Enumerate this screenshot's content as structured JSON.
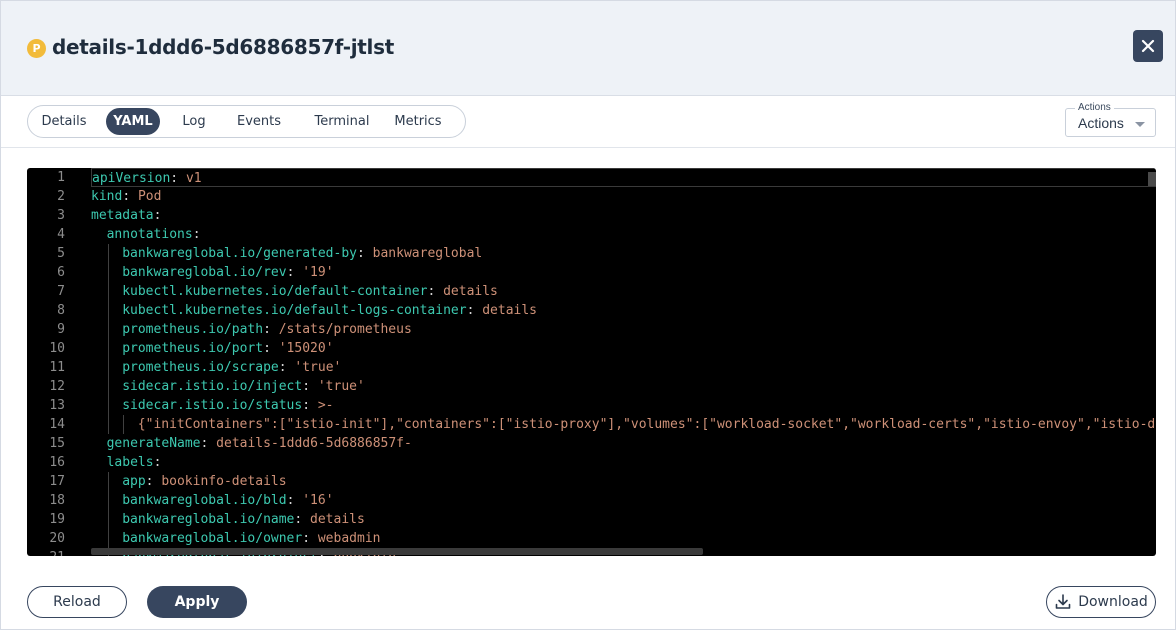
{
  "header": {
    "badge": "P",
    "title": "details-1ddd6-5d6886857f-jtlst"
  },
  "tabs": [
    {
      "label": "Details"
    },
    {
      "label": "YAML",
      "active": true
    },
    {
      "label": "Log"
    },
    {
      "label": "Events"
    },
    {
      "label": "Terminal"
    },
    {
      "label": "Metrics"
    }
  ],
  "actions": {
    "legend": "Actions",
    "value": "Actions"
  },
  "editor": {
    "lines": [
      {
        "n": "1",
        "indent": 0,
        "key": "apiVersion",
        "sep": ": ",
        "val": "v1"
      },
      {
        "n": "2",
        "indent": 0,
        "key": "kind",
        "sep": ": ",
        "val": "Pod"
      },
      {
        "n": "3",
        "indent": 0,
        "key": "metadata",
        "sep": ":",
        "val": ""
      },
      {
        "n": "4",
        "indent": 1,
        "key": "annotations",
        "sep": ":",
        "val": ""
      },
      {
        "n": "5",
        "indent": 2,
        "key": "bankwareglobal.io/generated-by",
        "sep": ": ",
        "val": "bankwareglobal"
      },
      {
        "n": "6",
        "indent": 2,
        "key": "bankwareglobal.io/rev",
        "sep": ": ",
        "val": "'19'"
      },
      {
        "n": "7",
        "indent": 2,
        "key": "kubectl.kubernetes.io/default-container",
        "sep": ": ",
        "val": "details"
      },
      {
        "n": "8",
        "indent": 2,
        "key": "kubectl.kubernetes.io/default-logs-container",
        "sep": ": ",
        "val": "details"
      },
      {
        "n": "9",
        "indent": 2,
        "key": "prometheus.io/path",
        "sep": ": ",
        "val": "/stats/prometheus"
      },
      {
        "n": "10",
        "indent": 2,
        "key": "prometheus.io/port",
        "sep": ": ",
        "val": "'15020'"
      },
      {
        "n": "11",
        "indent": 2,
        "key": "prometheus.io/scrape",
        "sep": ": ",
        "val": "'true'"
      },
      {
        "n": "12",
        "indent": 2,
        "key": "sidecar.istio.io/inject",
        "sep": ": ",
        "val": "'true'"
      },
      {
        "n": "13",
        "indent": 2,
        "key": "sidecar.istio.io/status",
        "sep": ": ",
        "val": ">-"
      },
      {
        "n": "14",
        "indent": 3,
        "key": "",
        "sep": "",
        "val": "{\"initContainers\":[\"istio-init\"],\"containers\":[\"istio-proxy\"],\"volumes\":[\"workload-socket\",\"workload-certs\",\"istio-envoy\",\"istio-data"
      },
      {
        "n": "15",
        "indent": 1,
        "key": "generateName",
        "sep": ": ",
        "val": "details-1ddd6-5d6886857f-"
      },
      {
        "n": "16",
        "indent": 1,
        "key": "labels",
        "sep": ":",
        "val": ""
      },
      {
        "n": "17",
        "indent": 2,
        "key": "app",
        "sep": ": ",
        "val": "bookinfo-details"
      },
      {
        "n": "18",
        "indent": 2,
        "key": "bankwareglobal.io/bld",
        "sep": ": ",
        "val": "'16'"
      },
      {
        "n": "19",
        "indent": 2,
        "key": "bankwareglobal.io/name",
        "sep": ": ",
        "val": "details"
      },
      {
        "n": "20",
        "indent": 2,
        "key": "bankwareglobal.io/owner",
        "sep": ": ",
        "val": "webadmin"
      },
      {
        "n": "21",
        "indent": 2,
        "key": "bankwareglobal.io/project",
        "sep": ": ",
        "val": "bookinfo"
      }
    ]
  },
  "footer": {
    "reload_label": "Reload",
    "apply_label": "Apply",
    "download_label": "Download"
  },
  "colors": {
    "primary": "#37465f",
    "badge": "#f2bb3a",
    "yaml_key": "#3dc9b0",
    "yaml_value": "#ce9178",
    "editor_bg": "#000000"
  }
}
